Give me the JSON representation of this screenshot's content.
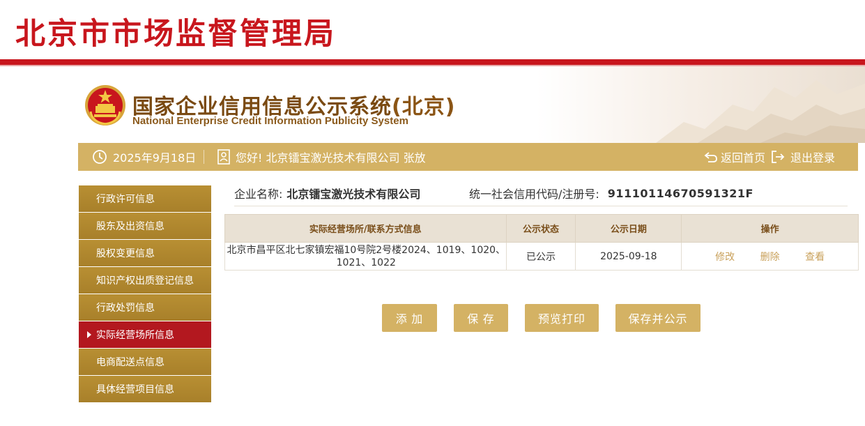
{
  "bureau": {
    "title": "北京市市场监督管理局"
  },
  "system": {
    "title": "国家企业信用信息公示系统",
    "region": "(北京)",
    "subtitle": "National Enterprise Credit Information Publicity System"
  },
  "info_bar": {
    "date": "2025年9月18日",
    "greeting": "您好! 北京镭宝激光技术有限公司 张放",
    "home_label": "返回首页",
    "logout_label": "退出登录"
  },
  "sidebar": {
    "items": [
      {
        "label": "行政许可信息",
        "active": false
      },
      {
        "label": "股东及出资信息",
        "active": false
      },
      {
        "label": "股权变更信息",
        "active": false
      },
      {
        "label": "知识产权出质登记信息",
        "active": false
      },
      {
        "label": "行政处罚信息",
        "active": false
      },
      {
        "label": "实际经营场所信息",
        "active": true
      },
      {
        "label": "电商配送点信息",
        "active": false
      },
      {
        "label": "具体经营项目信息",
        "active": false
      }
    ]
  },
  "company": {
    "name_label": "企业名称:",
    "name": "北京镭宝激光技术有限公司",
    "code_label": "统一社会信用代码/注册号:",
    "code": "91110114670591321F"
  },
  "table": {
    "headers": [
      "实际经营场所/联系方式信息",
      "公示状态",
      "公示日期",
      "操作"
    ],
    "rows": [
      {
        "address": "北京市昌平区北七家镇宏福10号院2号楼2024、1019、1020、1021、1022",
        "status": "已公示",
        "date": "2025-09-18",
        "actions": [
          "修改",
          "删除",
          "查看"
        ]
      }
    ]
  },
  "buttons": {
    "add": "添 加",
    "save": "保 存",
    "preview": "预览打印",
    "save_publish": "保存并公示"
  },
  "colors": {
    "bureau_red": "#c8161d",
    "gold": "#d4b264",
    "sidebar_gold": "#b08a30",
    "active_red": "#b3181f",
    "title_brown": "#7a4a12"
  }
}
